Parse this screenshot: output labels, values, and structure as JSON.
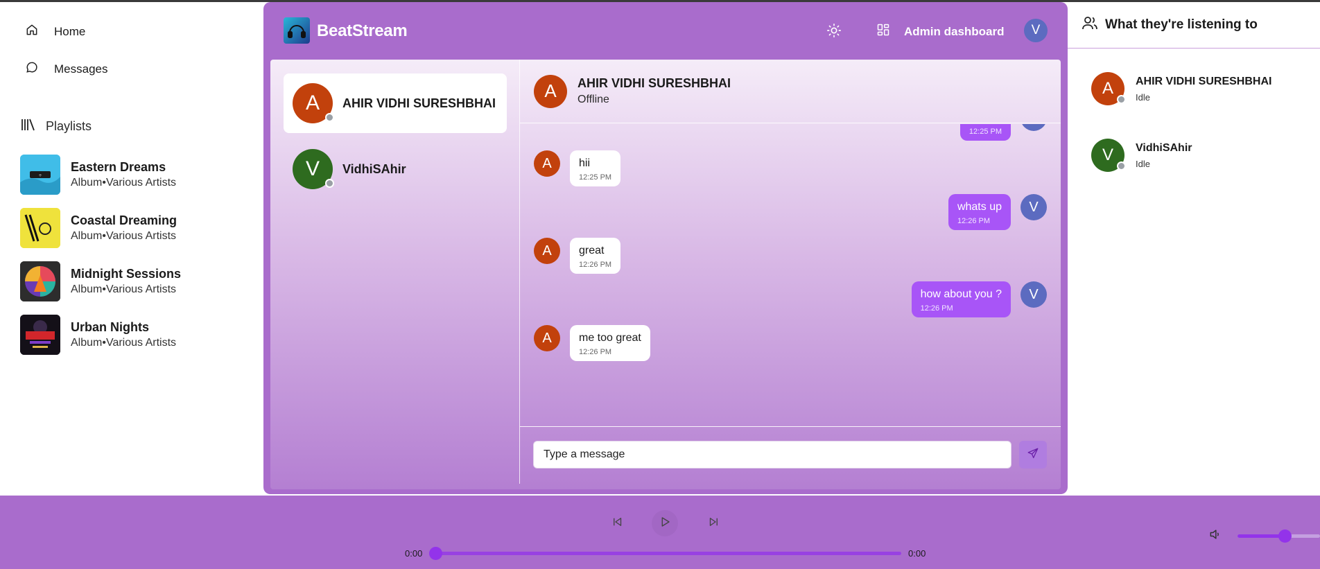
{
  "app": {
    "name": "BeatStream",
    "accent": "#a96ccc",
    "bubble_out": "#a855f7"
  },
  "nav": {
    "items": [
      {
        "label": "Home",
        "icon": "home-icon"
      },
      {
        "label": "Messages",
        "icon": "message-icon"
      }
    ],
    "playlists_title": "Playlists"
  },
  "playlists": [
    {
      "title": "Eastern Dreams",
      "subtitle": "Album•Various Artists"
    },
    {
      "title": "Coastal Dreaming",
      "subtitle": "Album•Various Artists"
    },
    {
      "title": "Midnight Sessions",
      "subtitle": "Album•Various Artists"
    },
    {
      "title": "Urban Nights",
      "subtitle": "Album•Various Artists"
    }
  ],
  "header": {
    "admin_label": "Admin dashboard",
    "user_initial": "V"
  },
  "contacts": [
    {
      "initial": "A",
      "name": "AHIR VIDHI SURESHBHAI",
      "color": "#c2410c"
    },
    {
      "initial": "V",
      "name": "VidhiSAhir",
      "color": "#2e6b1f"
    }
  ],
  "chat": {
    "contact_initial": "A",
    "contact_name": "AHIR VIDHI SURESHBHAI",
    "contact_status": "Offline",
    "messages": [
      {
        "from": "me",
        "text": "",
        "time": "12:25 PM"
      },
      {
        "from": "them",
        "text": "hii",
        "time": "12:25 PM"
      },
      {
        "from": "me",
        "text": "whats up",
        "time": "12:26 PM"
      },
      {
        "from": "them",
        "text": "great",
        "time": "12:26 PM"
      },
      {
        "from": "me",
        "text": "how about you ?",
        "time": "12:26 PM"
      },
      {
        "from": "them",
        "text": "me too great",
        "time": "12:26 PM"
      }
    ],
    "my_initial": "V",
    "their_initial": "A",
    "input_placeholder": "Type a message"
  },
  "friends": {
    "title": "What they're listening to",
    "items": [
      {
        "initial": "A",
        "name": "AHIR VIDHI SURESHBHAI",
        "status": "Idle",
        "color": "#c2410c"
      },
      {
        "initial": "V",
        "name": "VidhiSAhir",
        "status": "Idle",
        "color": "#2e6b1f"
      }
    ]
  },
  "player": {
    "current_time": "0:00",
    "duration": "0:00",
    "progress": 0,
    "volume": 0.57
  }
}
